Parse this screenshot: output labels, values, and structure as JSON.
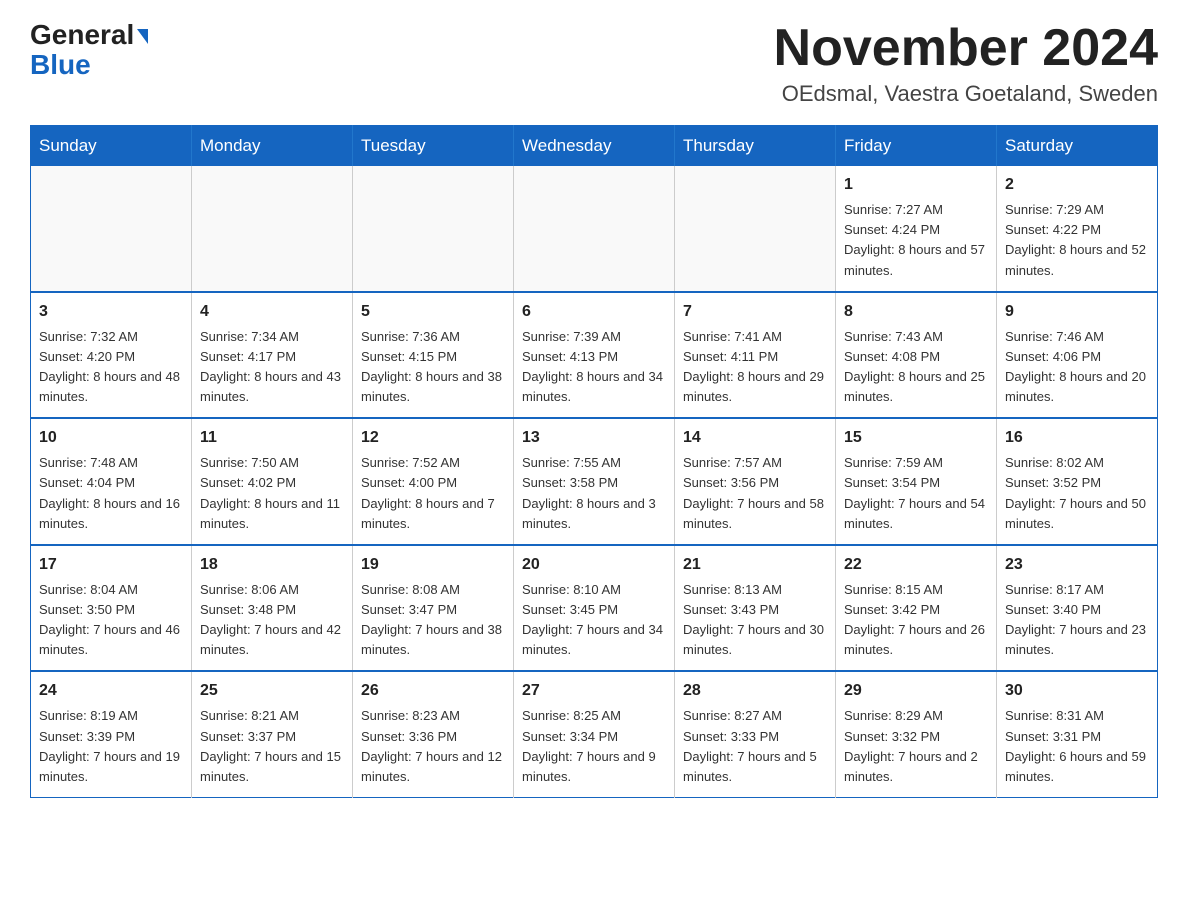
{
  "header": {
    "logo_line1": "General",
    "logo_line2": "Blue",
    "main_title": "November 2024",
    "subtitle": "OEdsmal, Vaestra Goetaland, Sweden"
  },
  "calendar": {
    "days_of_week": [
      "Sunday",
      "Monday",
      "Tuesday",
      "Wednesday",
      "Thursday",
      "Friday",
      "Saturday"
    ],
    "weeks": [
      [
        {
          "day": "",
          "info": ""
        },
        {
          "day": "",
          "info": ""
        },
        {
          "day": "",
          "info": ""
        },
        {
          "day": "",
          "info": ""
        },
        {
          "day": "",
          "info": ""
        },
        {
          "day": "1",
          "info": "Sunrise: 7:27 AM\nSunset: 4:24 PM\nDaylight: 8 hours and 57 minutes."
        },
        {
          "day": "2",
          "info": "Sunrise: 7:29 AM\nSunset: 4:22 PM\nDaylight: 8 hours and 52 minutes."
        }
      ],
      [
        {
          "day": "3",
          "info": "Sunrise: 7:32 AM\nSunset: 4:20 PM\nDaylight: 8 hours and 48 minutes."
        },
        {
          "day": "4",
          "info": "Sunrise: 7:34 AM\nSunset: 4:17 PM\nDaylight: 8 hours and 43 minutes."
        },
        {
          "day": "5",
          "info": "Sunrise: 7:36 AM\nSunset: 4:15 PM\nDaylight: 8 hours and 38 minutes."
        },
        {
          "day": "6",
          "info": "Sunrise: 7:39 AM\nSunset: 4:13 PM\nDaylight: 8 hours and 34 minutes."
        },
        {
          "day": "7",
          "info": "Sunrise: 7:41 AM\nSunset: 4:11 PM\nDaylight: 8 hours and 29 minutes."
        },
        {
          "day": "8",
          "info": "Sunrise: 7:43 AM\nSunset: 4:08 PM\nDaylight: 8 hours and 25 minutes."
        },
        {
          "day": "9",
          "info": "Sunrise: 7:46 AM\nSunset: 4:06 PM\nDaylight: 8 hours and 20 minutes."
        }
      ],
      [
        {
          "day": "10",
          "info": "Sunrise: 7:48 AM\nSunset: 4:04 PM\nDaylight: 8 hours and 16 minutes."
        },
        {
          "day": "11",
          "info": "Sunrise: 7:50 AM\nSunset: 4:02 PM\nDaylight: 8 hours and 11 minutes."
        },
        {
          "day": "12",
          "info": "Sunrise: 7:52 AM\nSunset: 4:00 PM\nDaylight: 8 hours and 7 minutes."
        },
        {
          "day": "13",
          "info": "Sunrise: 7:55 AM\nSunset: 3:58 PM\nDaylight: 8 hours and 3 minutes."
        },
        {
          "day": "14",
          "info": "Sunrise: 7:57 AM\nSunset: 3:56 PM\nDaylight: 7 hours and 58 minutes."
        },
        {
          "day": "15",
          "info": "Sunrise: 7:59 AM\nSunset: 3:54 PM\nDaylight: 7 hours and 54 minutes."
        },
        {
          "day": "16",
          "info": "Sunrise: 8:02 AM\nSunset: 3:52 PM\nDaylight: 7 hours and 50 minutes."
        }
      ],
      [
        {
          "day": "17",
          "info": "Sunrise: 8:04 AM\nSunset: 3:50 PM\nDaylight: 7 hours and 46 minutes."
        },
        {
          "day": "18",
          "info": "Sunrise: 8:06 AM\nSunset: 3:48 PM\nDaylight: 7 hours and 42 minutes."
        },
        {
          "day": "19",
          "info": "Sunrise: 8:08 AM\nSunset: 3:47 PM\nDaylight: 7 hours and 38 minutes."
        },
        {
          "day": "20",
          "info": "Sunrise: 8:10 AM\nSunset: 3:45 PM\nDaylight: 7 hours and 34 minutes."
        },
        {
          "day": "21",
          "info": "Sunrise: 8:13 AM\nSunset: 3:43 PM\nDaylight: 7 hours and 30 minutes."
        },
        {
          "day": "22",
          "info": "Sunrise: 8:15 AM\nSunset: 3:42 PM\nDaylight: 7 hours and 26 minutes."
        },
        {
          "day": "23",
          "info": "Sunrise: 8:17 AM\nSunset: 3:40 PM\nDaylight: 7 hours and 23 minutes."
        }
      ],
      [
        {
          "day": "24",
          "info": "Sunrise: 8:19 AM\nSunset: 3:39 PM\nDaylight: 7 hours and 19 minutes."
        },
        {
          "day": "25",
          "info": "Sunrise: 8:21 AM\nSunset: 3:37 PM\nDaylight: 7 hours and 15 minutes."
        },
        {
          "day": "26",
          "info": "Sunrise: 8:23 AM\nSunset: 3:36 PM\nDaylight: 7 hours and 12 minutes."
        },
        {
          "day": "27",
          "info": "Sunrise: 8:25 AM\nSunset: 3:34 PM\nDaylight: 7 hours and 9 minutes."
        },
        {
          "day": "28",
          "info": "Sunrise: 8:27 AM\nSunset: 3:33 PM\nDaylight: 7 hours and 5 minutes."
        },
        {
          "day": "29",
          "info": "Sunrise: 8:29 AM\nSunset: 3:32 PM\nDaylight: 7 hours and 2 minutes."
        },
        {
          "day": "30",
          "info": "Sunrise: 8:31 AM\nSunset: 3:31 PM\nDaylight: 6 hours and 59 minutes."
        }
      ]
    ]
  }
}
